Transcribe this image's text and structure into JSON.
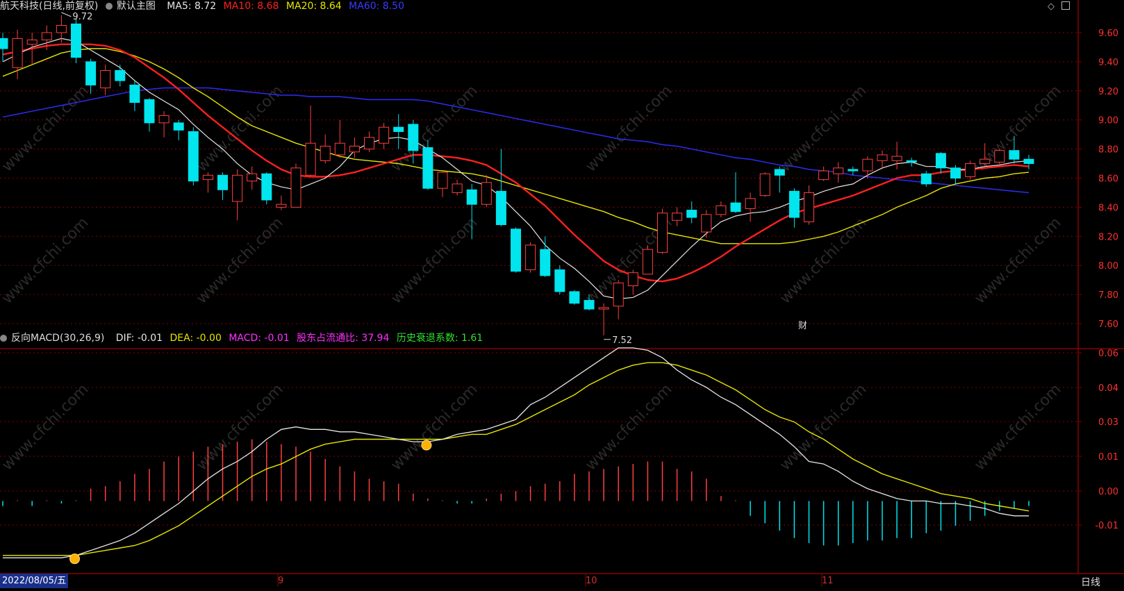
{
  "header": {
    "stock_name": "航天科技",
    "mode": "(日线,前复权)",
    "template_label": "默认主图",
    "ma5": "MA5: 8.72",
    "ma10": "MA10: 8.68",
    "ma20": "MA20: 8.64",
    "ma60": "MA60: 8.50"
  },
  "indicator": {
    "name": "反向MACD(30,26,9)",
    "dif": "DIF: -0.01",
    "dea": "DEA: -0.00",
    "macd": "MACD: -0.01",
    "holder_ratio": "股东占流通比: 37.94",
    "decay": "历史衰退系数: 1.61"
  },
  "colors": {
    "up": "#ff4040",
    "down": "#00e5ee",
    "ma5": "#e6e6e6",
    "ma10": "#ff2020",
    "ma20": "#e6e600",
    "ma60": "#2a2ae6",
    "grid": "#8b0000",
    "axis_text": "#ff3030",
    "dif": "#e6e6e6",
    "dea": "#e6e600"
  },
  "footer": {
    "start_date": "2022/08/05/五",
    "month_ticks": [
      "9",
      "10",
      "11"
    ],
    "period_button": "日线"
  },
  "annotations": {
    "high_label": "9.72",
    "low_label": "7.52",
    "fin_mark": "财"
  },
  "chart_data": [
    {
      "type": "candlestick",
      "ylim": [
        7.48,
        9.72
      ],
      "y_ticks": [
        "9.60",
        "9.40",
        "9.20",
        "9.00",
        "8.80",
        "8.60",
        "8.40",
        "8.20",
        "8.00",
        "7.80",
        "7.60"
      ],
      "candles": [
        {
          "o": 9.56,
          "c": 9.49,
          "h": 9.6,
          "l": 9.4
        },
        {
          "o": 9.36,
          "c": 9.56,
          "h": 9.62,
          "l": 9.28
        },
        {
          "o": 9.52,
          "c": 9.55,
          "h": 9.6,
          "l": 9.38
        },
        {
          "o": 9.55,
          "c": 9.6,
          "h": 9.65,
          "l": 9.48
        },
        {
          "o": 9.6,
          "c": 9.65,
          "h": 9.72,
          "l": 9.53
        },
        {
          "o": 9.66,
          "c": 9.43,
          "h": 9.7,
          "l": 9.39
        },
        {
          "o": 9.4,
          "c": 9.24,
          "h": 9.42,
          "l": 9.18
        },
        {
          "o": 9.22,
          "c": 9.34,
          "h": 9.38,
          "l": 9.17
        },
        {
          "o": 9.34,
          "c": 9.27,
          "h": 9.38,
          "l": 9.23
        },
        {
          "o": 9.24,
          "c": 9.12,
          "h": 9.27,
          "l": 9.06
        },
        {
          "o": 9.14,
          "c": 8.98,
          "h": 9.15,
          "l": 8.92
        },
        {
          "o": 8.98,
          "c": 9.03,
          "h": 9.06,
          "l": 8.88
        },
        {
          "o": 8.98,
          "c": 8.93,
          "h": 9.0,
          "l": 8.86
        },
        {
          "o": 8.92,
          "c": 8.58,
          "h": 8.95,
          "l": 8.55
        },
        {
          "o": 8.59,
          "c": 8.62,
          "h": 8.64,
          "l": 8.5
        },
        {
          "o": 8.62,
          "c": 8.52,
          "h": 8.64,
          "l": 8.45
        },
        {
          "o": 8.44,
          "c": 8.62,
          "h": 8.66,
          "l": 8.31
        },
        {
          "o": 8.58,
          "c": 8.63,
          "h": 8.68,
          "l": 8.52
        },
        {
          "o": 8.63,
          "c": 8.45,
          "h": 8.64,
          "l": 8.42
        },
        {
          "o": 8.4,
          "c": 8.42,
          "h": 8.48,
          "l": 8.38
        },
        {
          "o": 8.4,
          "c": 8.67,
          "h": 8.7,
          "l": 8.4
        },
        {
          "o": 8.62,
          "c": 8.84,
          "h": 9.1,
          "l": 8.61
        },
        {
          "o": 8.72,
          "c": 8.82,
          "h": 8.9,
          "l": 8.7
        },
        {
          "o": 8.76,
          "c": 8.84,
          "h": 9.0,
          "l": 8.74
        },
        {
          "o": 8.78,
          "c": 8.82,
          "h": 8.88,
          "l": 8.74
        },
        {
          "o": 8.8,
          "c": 8.88,
          "h": 8.92,
          "l": 8.78
        },
        {
          "o": 8.84,
          "c": 8.95,
          "h": 8.98,
          "l": 8.8
        },
        {
          "o": 8.95,
          "c": 8.92,
          "h": 9.04,
          "l": 8.8
        },
        {
          "o": 8.97,
          "c": 8.79,
          "h": 9.0,
          "l": 8.7
        },
        {
          "o": 8.81,
          "c": 8.53,
          "h": 8.86,
          "l": 8.52
        },
        {
          "o": 8.53,
          "c": 8.64,
          "h": 8.65,
          "l": 8.47
        },
        {
          "o": 8.5,
          "c": 8.56,
          "h": 8.59,
          "l": 8.48
        },
        {
          "o": 8.52,
          "c": 8.42,
          "h": 8.56,
          "l": 8.18
        },
        {
          "o": 8.42,
          "c": 8.57,
          "h": 8.62,
          "l": 8.4
        },
        {
          "o": 8.51,
          "c": 8.28,
          "h": 8.8,
          "l": 8.27
        },
        {
          "o": 8.25,
          "c": 7.96,
          "h": 8.26,
          "l": 7.95
        },
        {
          "o": 7.97,
          "c": 8.14,
          "h": 8.16,
          "l": 7.95
        },
        {
          "o": 8.11,
          "c": 7.93,
          "h": 8.2,
          "l": 7.92
        },
        {
          "o": 7.97,
          "c": 7.82,
          "h": 8.0,
          "l": 7.8
        },
        {
          "o": 7.82,
          "c": 7.74,
          "h": 7.83,
          "l": 7.73
        },
        {
          "o": 7.76,
          "c": 7.7,
          "h": 7.8,
          "l": 7.69
        },
        {
          "o": 7.7,
          "c": 7.71,
          "h": 7.74,
          "l": 7.52
        },
        {
          "o": 7.72,
          "c": 7.88,
          "h": 7.9,
          "l": 7.63
        },
        {
          "o": 7.86,
          "c": 7.95,
          "h": 7.97,
          "l": 7.8
        },
        {
          "o": 7.94,
          "c": 8.11,
          "h": 8.14,
          "l": 7.94
        },
        {
          "o": 8.09,
          "c": 8.36,
          "h": 8.39,
          "l": 8.08
        },
        {
          "o": 8.31,
          "c": 8.36,
          "h": 8.4,
          "l": 8.27
        },
        {
          "o": 8.38,
          "c": 8.33,
          "h": 8.44,
          "l": 8.29
        },
        {
          "o": 8.23,
          "c": 8.35,
          "h": 8.38,
          "l": 8.19
        },
        {
          "o": 8.35,
          "c": 8.41,
          "h": 8.44,
          "l": 8.33
        },
        {
          "o": 8.43,
          "c": 8.37,
          "h": 8.64,
          "l": 8.36
        },
        {
          "o": 8.39,
          "c": 8.46,
          "h": 8.5,
          "l": 8.3
        },
        {
          "o": 8.48,
          "c": 8.63,
          "h": 8.64,
          "l": 8.47
        },
        {
          "o": 8.66,
          "c": 8.62,
          "h": 8.68,
          "l": 8.5
        },
        {
          "o": 8.51,
          "c": 8.33,
          "h": 8.53,
          "l": 8.26
        },
        {
          "o": 8.3,
          "c": 8.5,
          "h": 8.55,
          "l": 8.28
        },
        {
          "o": 8.59,
          "c": 8.65,
          "h": 8.68,
          "l": 8.58
        },
        {
          "o": 8.63,
          "c": 8.67,
          "h": 8.71,
          "l": 8.57
        },
        {
          "o": 8.66,
          "c": 8.65,
          "h": 8.68,
          "l": 8.62
        },
        {
          "o": 8.65,
          "c": 8.73,
          "h": 8.75,
          "l": 8.6
        },
        {
          "o": 8.72,
          "c": 8.76,
          "h": 8.79,
          "l": 8.66
        },
        {
          "o": 8.72,
          "c": 8.75,
          "h": 8.85,
          "l": 8.66
        },
        {
          "o": 8.72,
          "c": 8.71,
          "h": 8.74,
          "l": 8.68
        },
        {
          "o": 8.63,
          "c": 8.56,
          "h": 8.65,
          "l": 8.54
        },
        {
          "o": 8.77,
          "c": 8.67,
          "h": 8.78,
          "l": 8.63
        },
        {
          "o": 8.67,
          "c": 8.6,
          "h": 8.69,
          "l": 8.56
        },
        {
          "o": 8.61,
          "c": 8.7,
          "h": 8.72,
          "l": 8.59
        },
        {
          "o": 8.7,
          "c": 8.73,
          "h": 8.84,
          "l": 8.69
        },
        {
          "o": 8.71,
          "c": 8.79,
          "h": 8.8,
          "l": 8.68
        },
        {
          "o": 8.79,
          "c": 8.73,
          "h": 8.89,
          "l": 8.7
        },
        {
          "o": 8.73,
          "c": 8.7,
          "h": 8.76,
          "l": 8.66
        }
      ],
      "ma5": [
        9.4,
        9.45,
        9.5,
        9.53,
        9.56,
        9.54,
        9.48,
        9.42,
        9.36,
        9.27,
        9.19,
        9.13,
        9.07,
        8.97,
        8.88,
        8.8,
        8.7,
        8.62,
        8.57,
        8.54,
        8.52,
        8.56,
        8.6,
        8.68,
        8.79,
        8.84,
        8.87,
        8.88,
        8.86,
        8.8,
        8.74,
        8.66,
        8.58,
        8.55,
        8.47,
        8.37,
        8.27,
        8.14,
        8.05,
        7.98,
        7.89,
        7.79,
        7.77,
        7.78,
        7.83,
        7.93,
        8.03,
        8.13,
        8.22,
        8.3,
        8.34,
        8.36,
        8.37,
        8.4,
        8.44,
        8.47,
        8.51,
        8.54,
        8.56,
        8.62,
        8.67,
        8.7,
        8.71,
        8.68,
        8.68,
        8.66,
        8.66,
        8.68,
        8.69,
        8.71,
        8.72
      ],
      "ma10": [
        9.45,
        9.47,
        9.49,
        9.51,
        9.52,
        9.52,
        9.52,
        9.51,
        9.48,
        9.43,
        9.36,
        9.29,
        9.21,
        9.12,
        9.03,
        8.95,
        8.87,
        8.79,
        8.72,
        8.66,
        8.62,
        8.61,
        8.61,
        8.62,
        8.64,
        8.67,
        8.7,
        8.73,
        8.76,
        8.76,
        8.75,
        8.74,
        8.72,
        8.69,
        8.63,
        8.57,
        8.49,
        8.41,
        8.31,
        8.21,
        8.12,
        8.03,
        7.97,
        7.93,
        7.9,
        7.89,
        7.91,
        7.95,
        8.0,
        8.06,
        8.13,
        8.19,
        8.25,
        8.31,
        8.36,
        8.39,
        8.42,
        8.45,
        8.48,
        8.52,
        8.56,
        8.6,
        8.62,
        8.62,
        8.64,
        8.65,
        8.66,
        8.67,
        8.68,
        8.69,
        8.68
      ],
      "ma20": [
        9.3,
        9.34,
        9.38,
        9.42,
        9.46,
        9.48,
        9.49,
        9.49,
        9.47,
        9.44,
        9.4,
        9.35,
        9.29,
        9.22,
        9.16,
        9.09,
        9.02,
        8.96,
        8.92,
        8.88,
        8.84,
        8.81,
        8.78,
        8.75,
        8.73,
        8.72,
        8.71,
        8.7,
        8.68,
        8.66,
        8.65,
        8.64,
        8.63,
        8.61,
        8.58,
        8.55,
        8.52,
        8.49,
        8.46,
        8.43,
        8.4,
        8.37,
        8.33,
        8.3,
        8.26,
        8.23,
        8.21,
        8.19,
        8.17,
        8.15,
        8.15,
        8.15,
        8.15,
        8.15,
        8.16,
        8.18,
        8.2,
        8.23,
        8.27,
        8.31,
        8.35,
        8.4,
        8.44,
        8.48,
        8.53,
        8.56,
        8.58,
        8.6,
        8.61,
        8.63,
        8.64
      ],
      "ma60": [
        9.02,
        9.04,
        9.06,
        9.08,
        9.1,
        9.12,
        9.14,
        9.16,
        9.18,
        9.2,
        9.21,
        9.22,
        9.22,
        9.22,
        9.22,
        9.21,
        9.2,
        9.19,
        9.18,
        9.17,
        9.17,
        9.16,
        9.16,
        9.16,
        9.15,
        9.14,
        9.14,
        9.14,
        9.14,
        9.13,
        9.11,
        9.09,
        9.07,
        9.05,
        9.03,
        9.01,
        8.99,
        8.97,
        8.95,
        8.93,
        8.91,
        8.89,
        8.87,
        8.86,
        8.85,
        8.83,
        8.82,
        8.8,
        8.78,
        8.76,
        8.74,
        8.73,
        8.71,
        8.69,
        8.68,
        8.66,
        8.65,
        8.64,
        8.62,
        8.61,
        8.6,
        8.59,
        8.58,
        8.57,
        8.56,
        8.55,
        8.54,
        8.53,
        8.52,
        8.51,
        8.5
      ]
    },
    {
      "type": "bar",
      "ylim": [
        -0.025,
        0.065
      ],
      "y_ticks": [
        "0.06",
        "0.04",
        "0.03",
        "0.01",
        "0.00",
        "-0.01"
      ],
      "macd": [
        -0.002,
        0.0,
        -0.002,
        0.0,
        0.0,
        0.0,
        0.0,
        -0.002,
        -0.001,
        -0.001,
        0.0,
        0.0,
        0.0,
        0.0,
        0.0,
        0.0,
        0.0,
        0.0,
        0.0,
        0.0,
        0.0,
        0.0,
        0.0,
        0.0,
        0.0,
        0.0,
        0.0,
        0.0,
        0.0,
        0.0,
        0.0,
        0.0,
        0.0,
        0.0,
        0.0,
        0.0,
        0.0,
        0.0,
        0.0,
        0.0,
        0.0,
        0.0,
        0.0,
        0.0,
        0.0,
        0.0,
        0.0,
        0.0,
        0.0,
        0.0,
        0.0,
        0.0,
        0.0,
        0.0,
        0.0,
        0.0,
        0.0,
        0.0,
        0.0,
        0.0,
        0.0,
        0.0,
        0.0,
        0.0,
        0.0,
        0.0,
        0.0,
        0.0,
        0.0,
        0.0,
        0.0
      ],
      "dif": [
        -0.023,
        -0.023,
        -0.023,
        -0.023,
        -0.023,
        -0.022,
        -0.02,
        -0.018,
        -0.016,
        -0.013,
        -0.009,
        -0.005,
        -0.001,
        0.004,
        0.009,
        0.013,
        0.016,
        0.02,
        0.025,
        0.029,
        0.03,
        0.029,
        0.029,
        0.028,
        0.028,
        0.027,
        0.026,
        0.025,
        0.024,
        0.024,
        0.025,
        0.027,
        0.028,
        0.029,
        0.031,
        0.033,
        0.039,
        0.042,
        0.046,
        0.05,
        0.054,
        0.058,
        0.062,
        0.062,
        0.061,
        0.058,
        0.053,
        0.049,
        0.046,
        0.042,
        0.039,
        0.035,
        0.031,
        0.027,
        0.022,
        0.016,
        0.015,
        0.012,
        0.008,
        0.005,
        0.003,
        0.001,
        0.0,
        0.0,
        -0.001,
        -0.001,
        -0.002,
        -0.003,
        -0.005,
        -0.006,
        -0.006
      ],
      "dea": [
        -0.022,
        -0.022,
        -0.022,
        -0.022,
        -0.022,
        -0.022,
        -0.021,
        -0.02,
        -0.019,
        -0.018,
        -0.016,
        -0.013,
        -0.01,
        -0.006,
        -0.002,
        0.002,
        0.006,
        0.01,
        0.013,
        0.015,
        0.018,
        0.021,
        0.023,
        0.024,
        0.025,
        0.025,
        0.025,
        0.025,
        0.025,
        0.025,
        0.025,
        0.026,
        0.027,
        0.027,
        0.029,
        0.031,
        0.034,
        0.037,
        0.04,
        0.043,
        0.047,
        0.05,
        0.053,
        0.055,
        0.056,
        0.056,
        0.055,
        0.053,
        0.051,
        0.048,
        0.045,
        0.041,
        0.037,
        0.034,
        0.032,
        0.028,
        0.025,
        0.021,
        0.017,
        0.014,
        0.011,
        0.009,
        0.007,
        0.005,
        0.003,
        0.002,
        0.001,
        -0.001,
        -0.002,
        -0.003,
        -0.004
      ],
      "histogram": [
        -0.002,
        0.0,
        -0.002,
        0.0,
        -0.001,
        0.0,
        0.005,
        0.006,
        0.008,
        0.011,
        0.013,
        0.016,
        0.018,
        0.02,
        0.022,
        0.023,
        0.024,
        0.025,
        0.024,
        0.023,
        0.022,
        0.02,
        0.017,
        0.014,
        0.012,
        0.009,
        0.008,
        0.007,
        0.003,
        0.001,
        0.0,
        -0.001,
        -0.001,
        0.001,
        0.003,
        0.004,
        0.006,
        0.007,
        0.008,
        0.011,
        0.012,
        0.013,
        0.014,
        0.015,
        0.016,
        0.016,
        0.013,
        0.012,
        0.009,
        0.002,
        0.0,
        -0.006,
        -0.009,
        -0.012,
        -0.015,
        -0.017,
        -0.018,
        -0.018,
        -0.017,
        -0.016,
        -0.016,
        -0.015,
        -0.015,
        -0.013,
        -0.012,
        -0.01,
        -0.008,
        -0.006,
        -0.004,
        -0.003,
        -0.002
      ]
    }
  ]
}
